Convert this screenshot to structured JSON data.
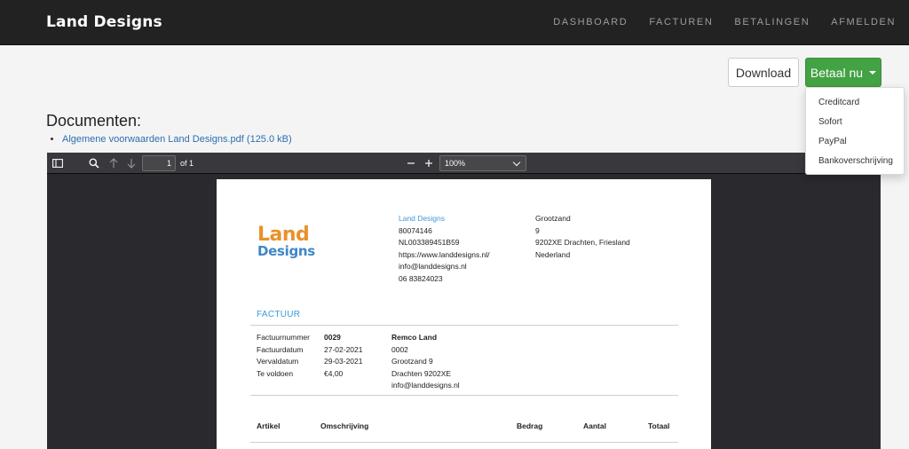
{
  "navbar": {
    "brand": "Land Designs",
    "links": [
      "DASHBOARD",
      "FACTUREN",
      "BETALINGEN",
      "AFMELDEN"
    ]
  },
  "actions": {
    "download_label": "Download",
    "pay_label": "Betaal nu",
    "pay_menu": [
      "Creditcard",
      "Sofort",
      "PayPal",
      "Bankoverschrijving"
    ]
  },
  "documents": {
    "heading": "Documenten:",
    "items": [
      "Algemene voorwaarden Land Designs.pdf (125.0 kB)"
    ]
  },
  "viewer": {
    "page_number": "1",
    "page_of": "of 1",
    "zoom": "100%"
  },
  "invoice": {
    "logo_line1": "Land",
    "logo_line2": "Designs",
    "company": {
      "name": "Land Designs",
      "kvk": "80074146",
      "vat": "NL003389451B59",
      "website": "https://www.landdesigns.nl/",
      "email": "info@landdesigns.nl",
      "phone": "06 83824023"
    },
    "address": {
      "street": "Grootzand",
      "number": "9",
      "city": "9202XE Drachten, Friesland",
      "country": "Nederland"
    },
    "title": "FACTUUR",
    "meta": {
      "labels": [
        "Factuurnummer",
        "Factuurdatum",
        "Vervaldatum",
        "Te voldoen"
      ],
      "values": [
        "0029",
        "27-02-2021",
        "29-03-2021",
        "€4,00"
      ]
    },
    "client": {
      "name": "Remco Land",
      "id": "0002",
      "street": "Grootzand 9",
      "city": "Drachten 9202XE",
      "email": "info@landdesigns.nl"
    },
    "table_headers": [
      "Artikel",
      "Omschrijving",
      "Bedrag",
      "Aantal",
      "Totaal"
    ]
  },
  "colors": {
    "navbar_bg": "#222222",
    "pay_button": "#43a243",
    "link": "#2a6fb0",
    "invoice_accent": "#3e9ad8",
    "logo_orange": "#e8922b",
    "logo_blue": "#3f86c7"
  }
}
